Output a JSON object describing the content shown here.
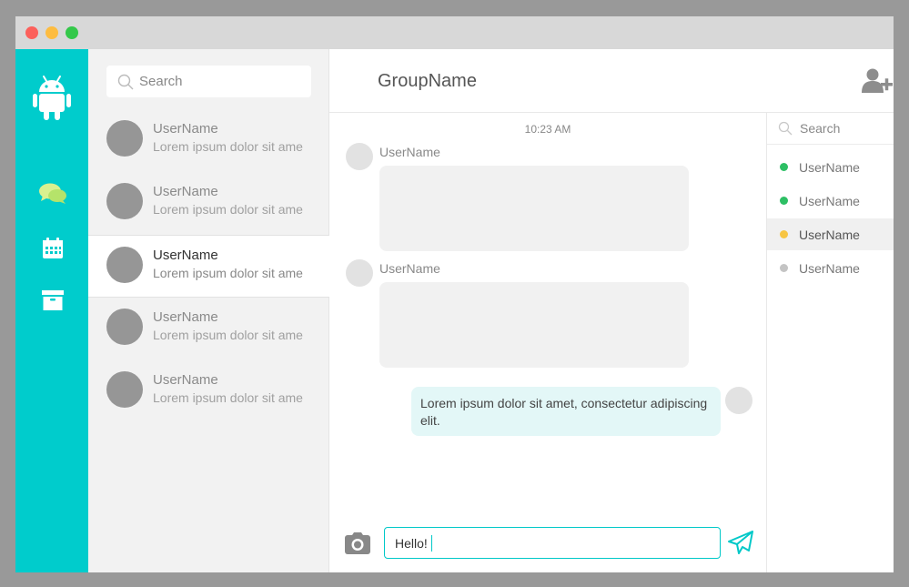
{
  "colors": {
    "accent": "#00cccc",
    "online": "#2dbf64",
    "away": "#f7c543",
    "offline": "#c4c4c4"
  },
  "sidebar": {
    "icons": [
      "android-logo-icon",
      "chat-bubbles-icon",
      "calendar-icon",
      "archive-icon"
    ]
  },
  "conversations": {
    "search_placeholder": "Search",
    "items": [
      {
        "name": "UserName",
        "preview": "Lorem ipsum dolor sit ame",
        "active": false
      },
      {
        "name": "UserName",
        "preview": "Lorem ipsum dolor sit ame",
        "active": false
      },
      {
        "name": "UserName",
        "preview": "Lorem ipsum dolor sit ame",
        "active": true
      },
      {
        "name": "UserName",
        "preview": "Lorem ipsum dolor sit ame",
        "active": false
      },
      {
        "name": "UserName",
        "preview": "Lorem ipsum dolor sit ame",
        "active": false
      }
    ]
  },
  "chat": {
    "group_name": "GroupName",
    "timestamp": "10:23 AM",
    "messages": [
      {
        "user": "UserName",
        "text": ""
      },
      {
        "user": "UserName",
        "text": ""
      }
    ],
    "own_message": "Lorem ipsum dolor sit amet, consectetur adipiscing elit.",
    "composer_value": "Hello!"
  },
  "members": {
    "search_placeholder": "Search",
    "items": [
      {
        "name": "UserName",
        "status": "online"
      },
      {
        "name": "UserName",
        "status": "online"
      },
      {
        "name": "UserName",
        "status": "away"
      },
      {
        "name": "UserName",
        "status": "offline"
      }
    ]
  }
}
